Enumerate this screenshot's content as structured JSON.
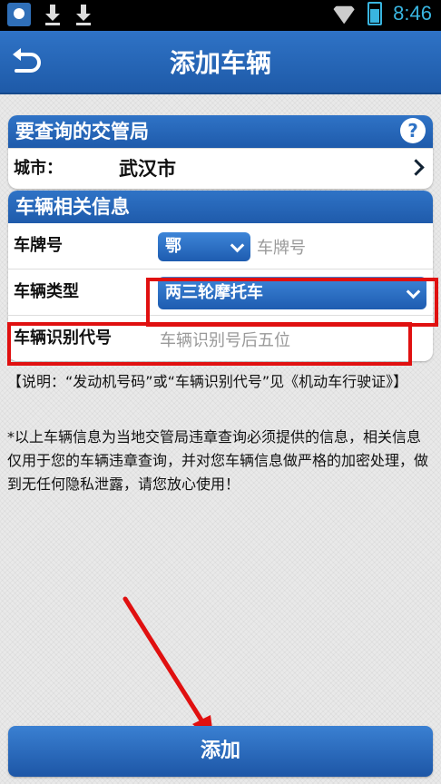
{
  "status_bar": {
    "time": "8:46",
    "accent_color": "#39b5e0"
  },
  "header": {
    "title": "添加车辆",
    "back_icon": "back-arrow-icon"
  },
  "bureau_card": {
    "title": "要查询的交管局",
    "help_symbol": "?",
    "city_label": "城市：",
    "city_value": "武汉市"
  },
  "vehicle_card": {
    "title": "车辆相关信息",
    "plate_label": "车牌号",
    "province_value": "鄂",
    "plate_placeholder": "车牌号",
    "type_label": "车辆类型",
    "type_value": "两三轮摩托车",
    "vin_label": "车辆识别代号",
    "vin_placeholder": "车辆识别号后五位"
  },
  "notes": {
    "explanation": "【说明：“发动机号码”或“车辆识别代号”见《机动车行驶证》】",
    "privacy": "*以上车辆信息为当地交管局违章查询必须提供的信息，相关信息仅用于您的车辆违章查询，并对您车辆信息做严格的加密处理，做到无任何隐私泄露，请您放心使用！"
  },
  "add_button": {
    "label": "添加"
  },
  "colors": {
    "primary": "#2f73c6",
    "highlight": "#e01010"
  }
}
